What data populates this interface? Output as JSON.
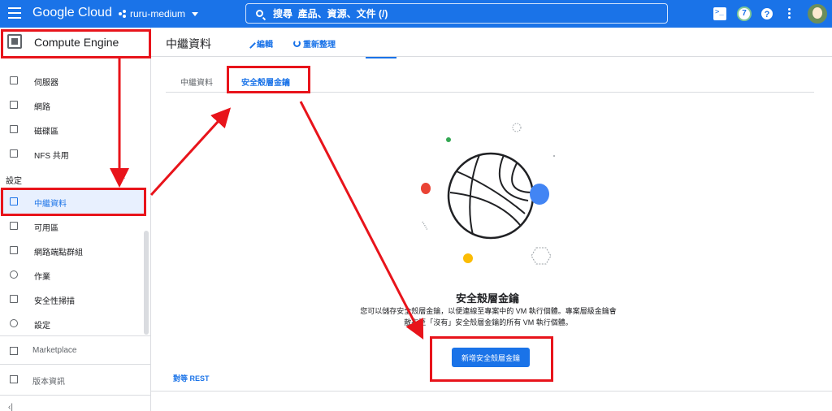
{
  "topbar": {
    "logo": "Google Cloud",
    "project": "ruru-medium",
    "search_placeholder": "搜尋  產品、資源、文件 (/)",
    "badge_count": "7",
    "help": "?"
  },
  "sidebar": {
    "title": "Compute Engine",
    "items_top": [
      {
        "label": "伺服器"
      },
      {
        "label": "網路"
      },
      {
        "label": "磁碟區"
      },
      {
        "label": "NFS 共用"
      }
    ],
    "section": "設定",
    "items_settings": [
      {
        "label": "中繼資料"
      },
      {
        "label": "可用區"
      },
      {
        "label": "網路端點群組"
      },
      {
        "label": "作業"
      },
      {
        "label": "安全性掃描"
      },
      {
        "label": "設定"
      }
    ],
    "bottom": [
      {
        "label": "Marketplace"
      },
      {
        "label": "版本資訊"
      }
    ]
  },
  "main": {
    "title": "中繼資料",
    "edit": "編輯",
    "refresh": "重新整理",
    "tabs": [
      {
        "label": "中繼資料"
      },
      {
        "label": "安全殼層金鑰"
      }
    ],
    "empty_title": "安全殼層金鑰",
    "empty_desc_line1": "您可以儲存安全殼層金鑰，以便連線至專案中的 VM 執行個體。專案層級金鑰會",
    "empty_desc_line2": "散布至「沒有」安全殼層金鑰的所有 VM 執行個體。",
    "add_button": "新增安全殼層金鑰",
    "peer_rest": "對等 REST"
  },
  "colors": {
    "brand_blue": "#1a73e8",
    "annotation_red": "#e8141b",
    "active_bg": "#e8f0fe"
  }
}
